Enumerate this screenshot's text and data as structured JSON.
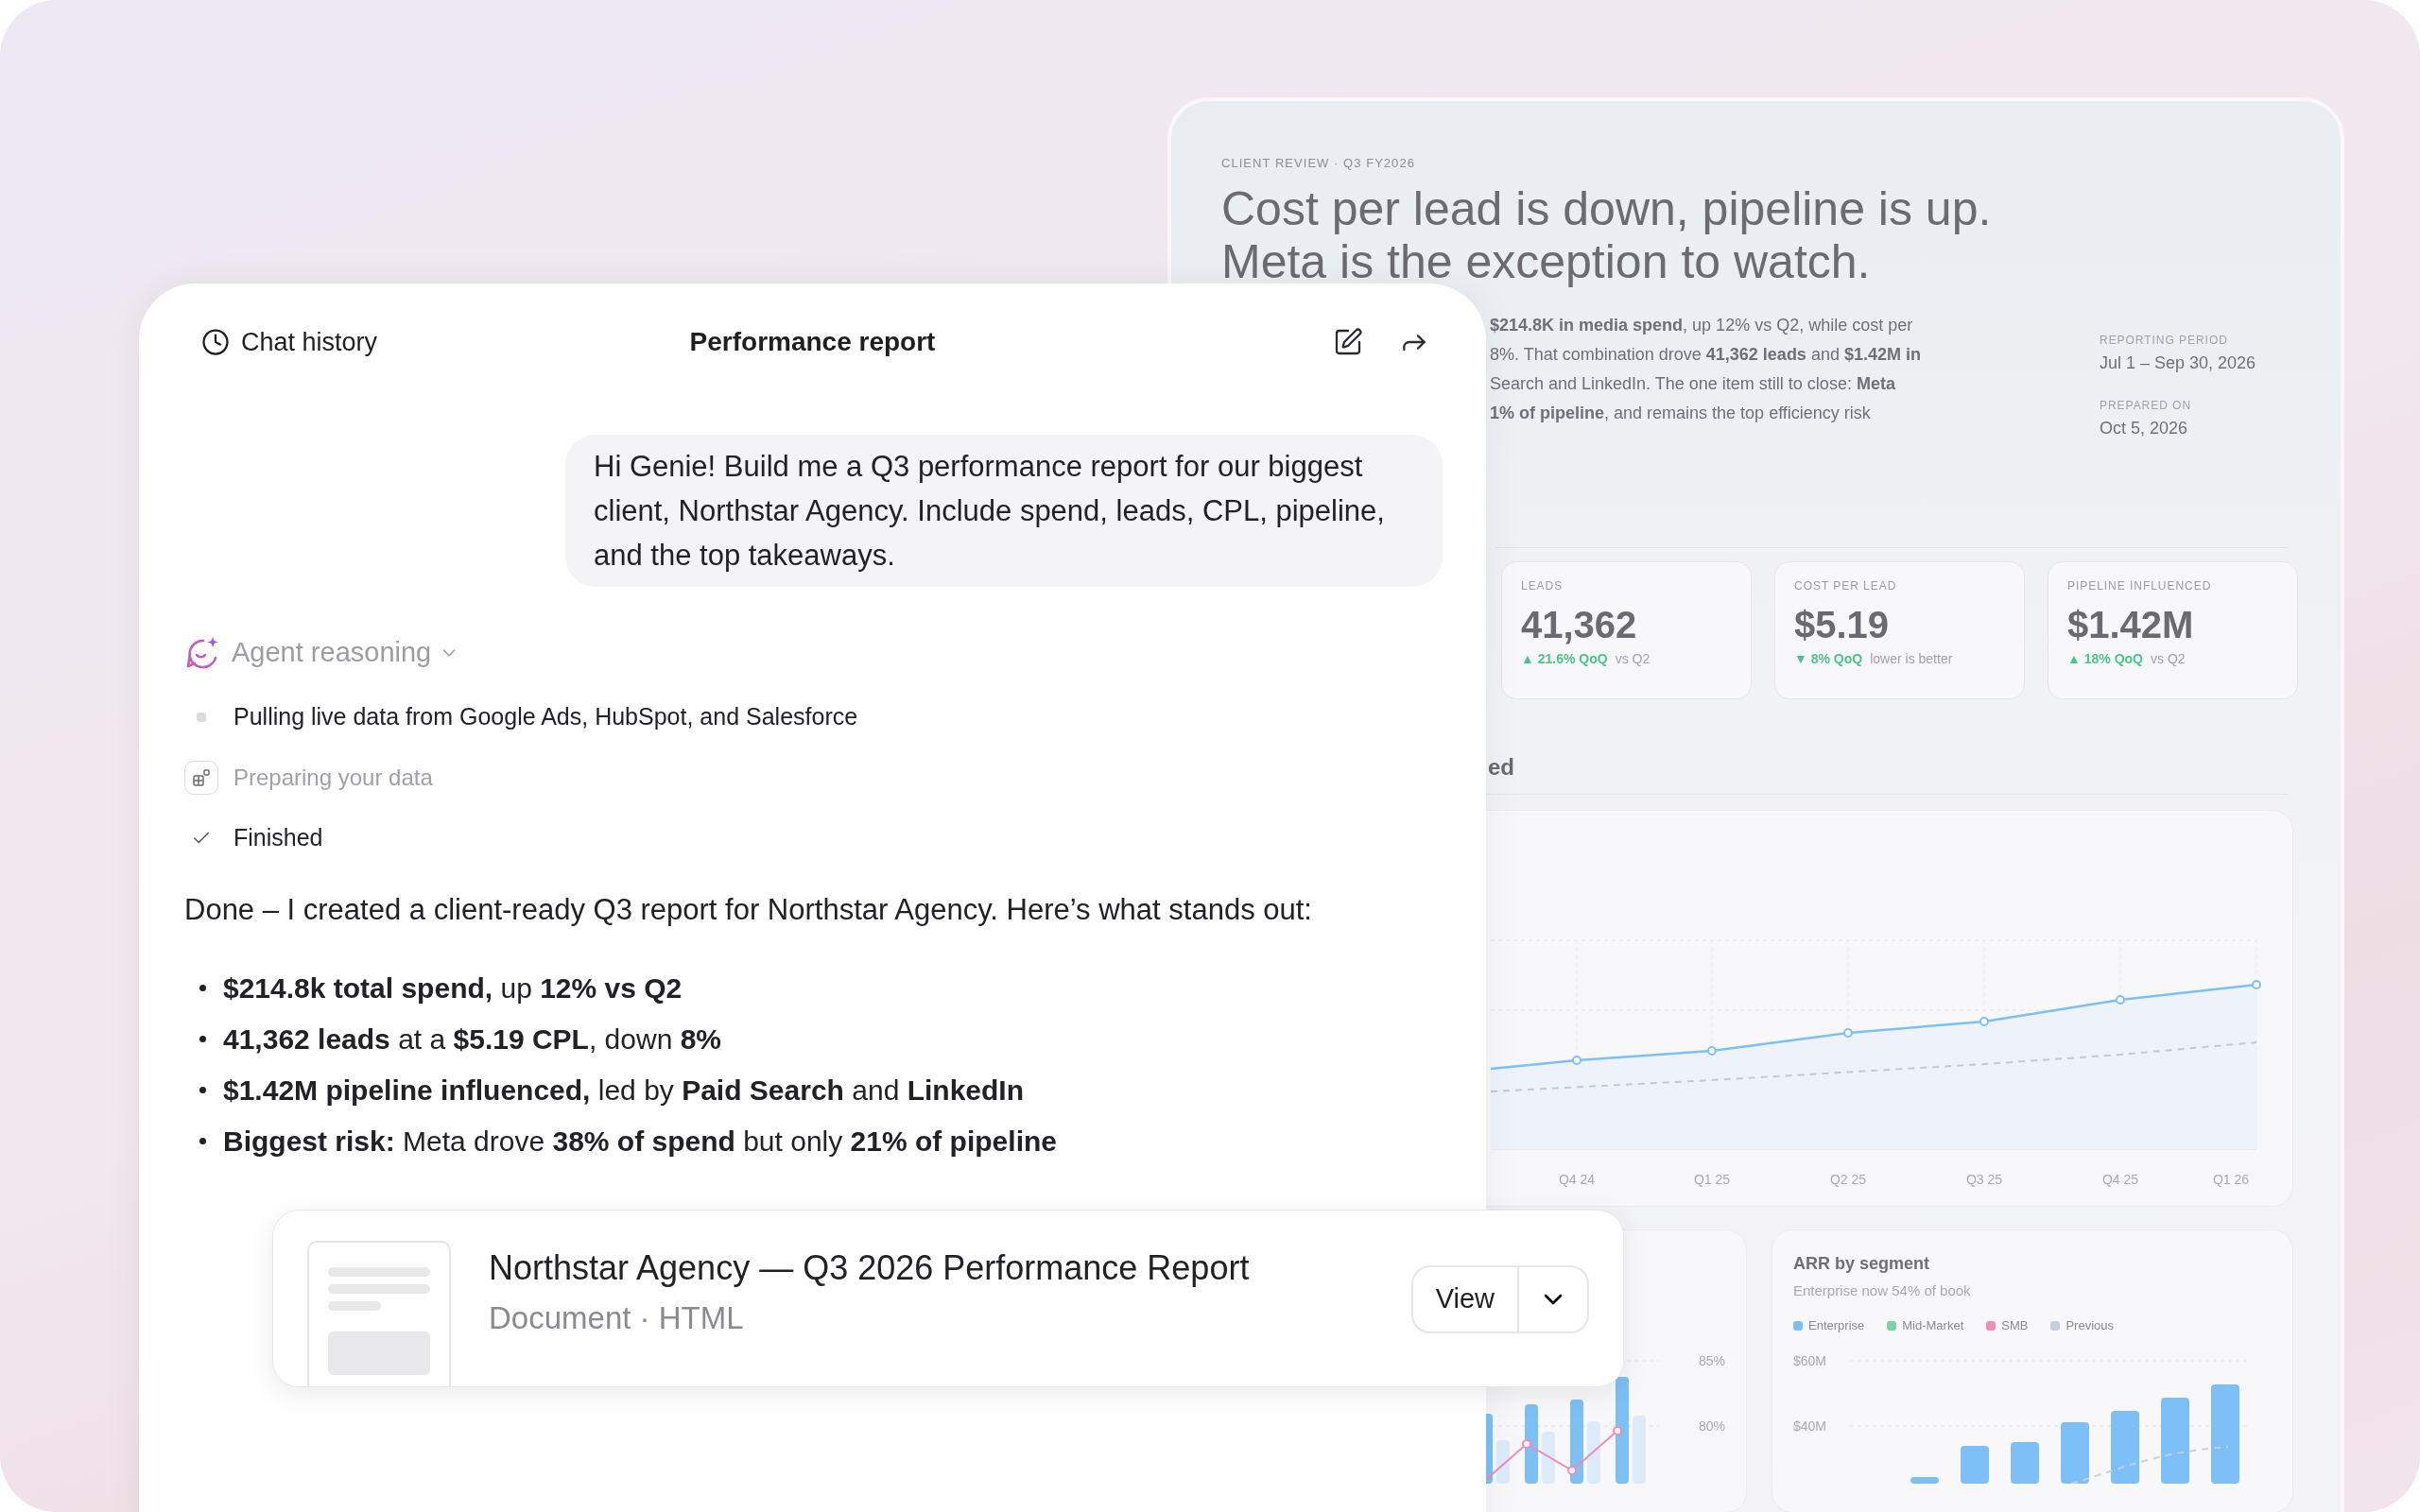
{
  "report": {
    "eyebrow": "CLIENT REVIEW · Q3 FY2026",
    "headline": [
      "Cost per lead is down, pipeline is up.",
      "Meta is the exception to watch."
    ],
    "summary_lines": [
      "**$214.8K in media spend**, up 12% vs Q2, while cost per",
      "8%. That combination drove **41,362 leads** and **$1.42M in**",
      "Search and LinkedIn. The one item still to close: **Meta**",
      "**1% of pipeline**, and remains the top efficiency risk"
    ],
    "meta": [
      {
        "label": "REPORTING PERIOD",
        "value": "Jul 1 – Sep 30, 2026"
      },
      {
        "label": "PREPARED ON",
        "value": "Oct 5, 2026"
      }
    ],
    "stats": [
      {
        "label": "LEADS",
        "value": "41,362",
        "delta": "▲ 21.6% QoQ",
        "note": "vs Q2"
      },
      {
        "label": "COST PER LEAD",
        "value": "$5.19",
        "delta": "▼ 8% QoQ",
        "note": "lower is better"
      },
      {
        "label": "PIPELINE INFLUENCED",
        "value": "$1.42M",
        "delta": "▲ 18% QoQ",
        "note": "vs Q2"
      }
    ],
    "section_heading": "ed",
    "trend_chart": {
      "x_labels": [
        "Q4 24",
        "Q1 25",
        "Q2 25",
        "Q3 25",
        "Q4 25",
        "Q1 26"
      ]
    },
    "mix_chart": {
      "axis_labels": [
        "85%",
        "80%"
      ]
    },
    "arr_card": {
      "title": "ARR by segment",
      "subtitle": "Enterprise now 54% of book",
      "legend": [
        {
          "label": "Enterprise",
          "color": "#7cc0f7"
        },
        {
          "label": "Mid-Market",
          "color": "#7dd3a8"
        },
        {
          "label": "SMB",
          "color": "#f08cb8"
        },
        {
          "label": "Previous",
          "color": "#c5cfe0"
        }
      ],
      "axis_labels": [
        "$60M",
        "$40M"
      ]
    }
  },
  "chat": {
    "history_label": "Chat history",
    "title": "Performance report",
    "user_message": "Hi Genie! Build me a Q3 performance report for our biggest client, Northstar Agency. Include spend, leads, CPL, pipeline, and the top takeaways.",
    "reasoning_label": "Agent reasoning",
    "steps": [
      {
        "kind": "pending",
        "text": "Pulling live data from Google Ads, HubSpot, and Salesforce"
      },
      {
        "kind": "working",
        "text": "Preparing your data"
      },
      {
        "kind": "done",
        "text": "Finished"
      }
    ],
    "reply_intro": "Done – I created a client-ready Q3 report for Northstar Agency. Here’s what stands out:",
    "bullets": [
      "**$214.8k total spend,** up **12% vs Q2**",
      "**41,362 leads** at a **$5.19 CPL**, down **8%**",
      "**$1.42M pipeline influenced,** led by **Paid Search** and **LinkedIn**",
      "**Biggest risk:** Meta drove **38% of spend** but only **21% of pipeline**"
    ],
    "artifact": {
      "title": "Northstar Agency — Q3 2026 Performance Report",
      "subtitle": "Document · HTML",
      "action": "View"
    }
  }
}
